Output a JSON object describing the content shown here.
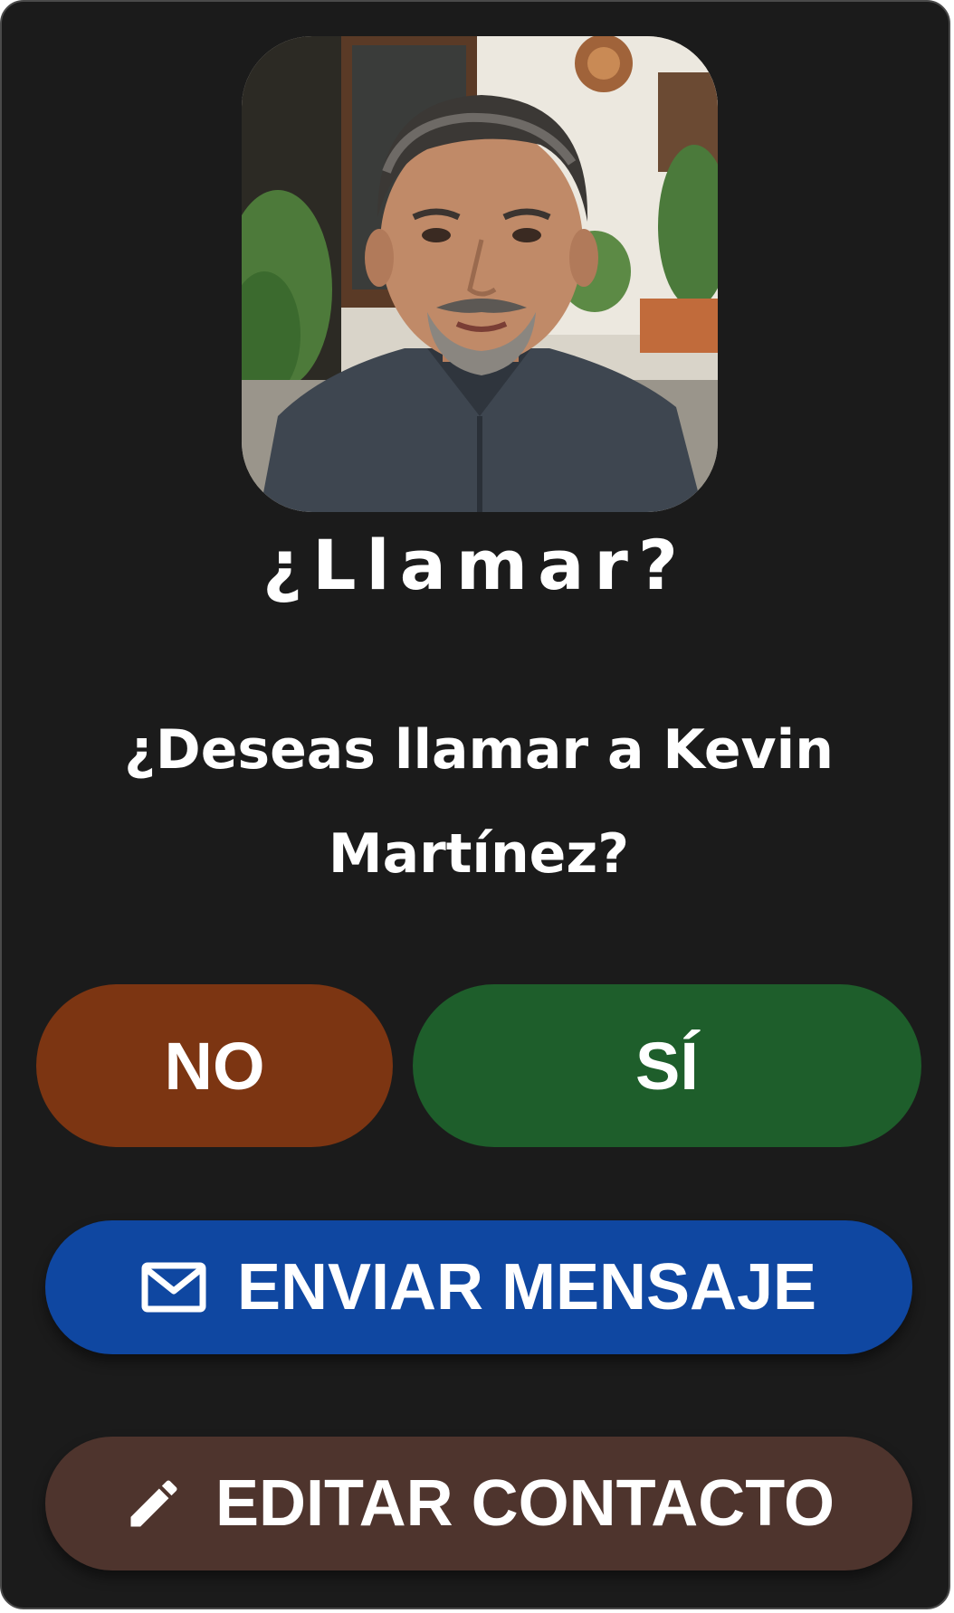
{
  "dialog": {
    "title": "¿Llamar?",
    "question": "¿Deseas llamar a Kevin Martínez?",
    "avatar_icon": "contact-photo"
  },
  "buttons": {
    "no_label": "NO",
    "yes_label": "SÍ",
    "message_label": "ENVIAR MENSAJE",
    "message_icon": "mail-icon",
    "edit_label": "EDITAR CONTACTO",
    "edit_icon": "pencil-icon"
  },
  "colors": {
    "background": "#1b1b1b",
    "no": "#7c3512",
    "yes": "#1e5e2b",
    "message": "#0f47a1",
    "edit": "#4e342d",
    "text": "#ffffff"
  }
}
